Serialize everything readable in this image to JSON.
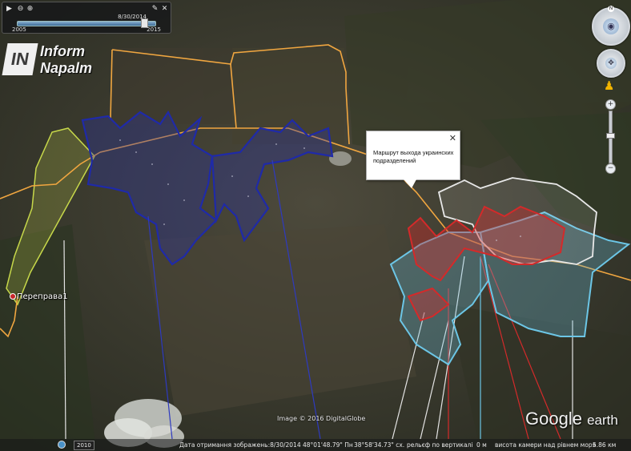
{
  "time_slider": {
    "current_date": "8/30/2014",
    "start_year": "2005",
    "end_year": "2015",
    "position": 0.93
  },
  "logo": {
    "line1": "Inform",
    "line2": "Napalm",
    "mark": "IN"
  },
  "balloon": {
    "text": "Маршрут выхода украинских подразделений",
    "close": "✕"
  },
  "placemark": {
    "label": "Переправа1"
  },
  "imagery_credit": "Image © 2016 DigitalGlobe",
  "brand": {
    "google": "Google",
    "earth": "earth"
  },
  "status_bar": {
    "historical_year": "2010",
    "imagery_date": "Дата отримання зображень:8/30/2014",
    "latitude": "48°01'48.79\" Пн",
    "longitude": "38°58'34.73\" сх.",
    "elevation_label": "рельєф по вертикалі",
    "elevation_value": "0 м",
    "eye_alt_label": "висота камери над рівнем моря",
    "eye_alt_value": "5.86 км"
  },
  "colors": {
    "route": "#f0a640",
    "unit_positions": "#1f2aa8",
    "red_zone": "#d42a2a",
    "light_blue_zone": "#6cc6e6",
    "white_zone": "#e8e8e8",
    "yellow_green_zone": "#c7d84a"
  },
  "icons": [
    "play-icon",
    "zoom-out-icon",
    "zoom-in-icon",
    "wrench-icon",
    "close-icon",
    "compass-icon",
    "look-icon",
    "pan-icon",
    "pegman-icon",
    "zoom-slider"
  ]
}
